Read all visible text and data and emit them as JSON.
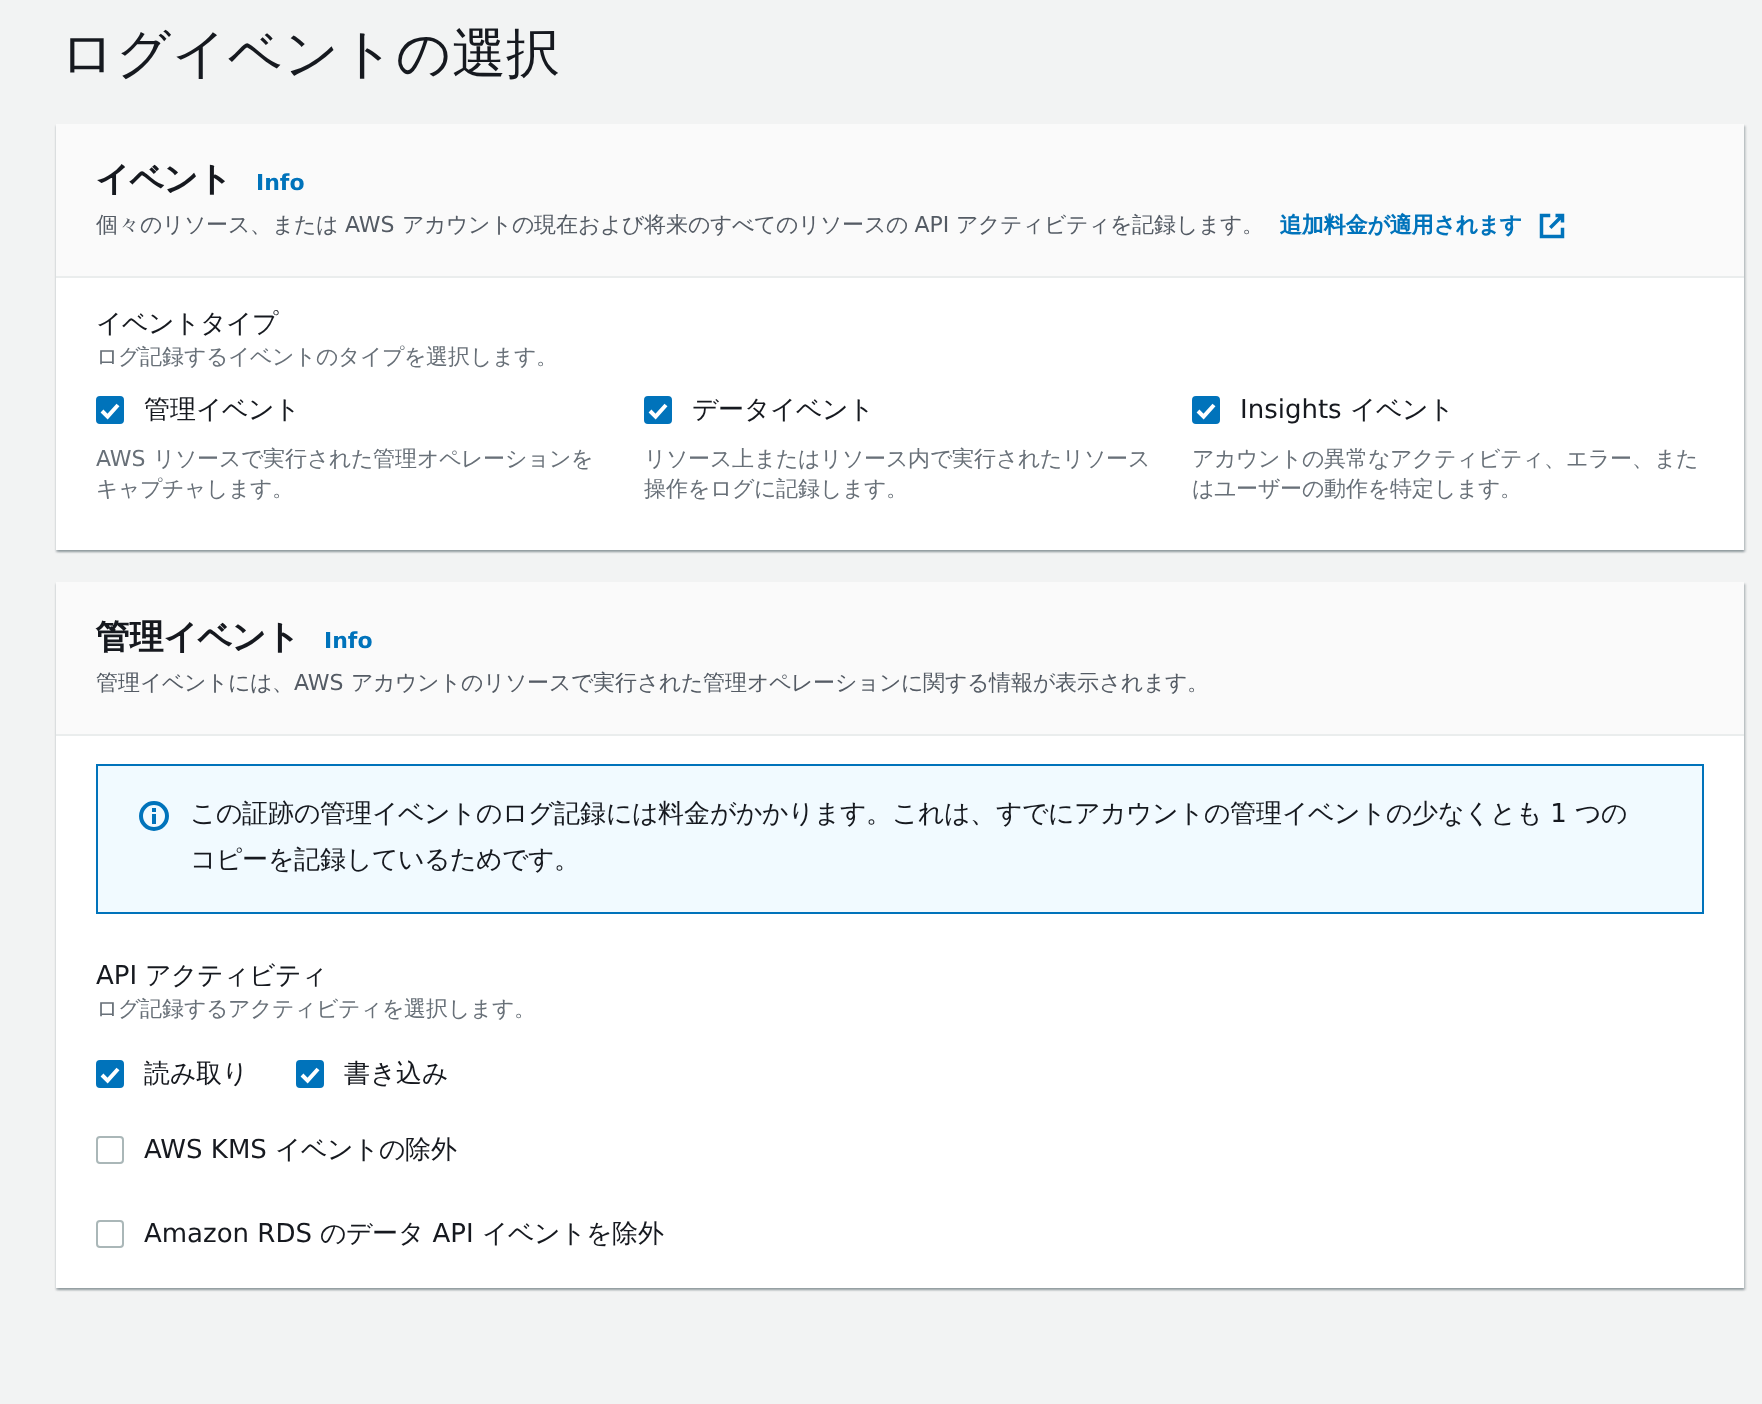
{
  "page_title": "ログイベントの選択",
  "events_panel": {
    "title": "イベント",
    "info": "Info",
    "description": "個々のリソース、または AWS アカウントの現在および将来のすべてのリソースの API アクティビティを記録します。",
    "link": "追加料金が適用されます",
    "event_type": {
      "label": "イベントタイプ",
      "hint": "ログ記録するイベントのタイプを選択します。",
      "options": [
        {
          "label": "管理イベント",
          "description": "AWS リソースで実行された管理オペレーションをキャプチャします。",
          "checked": true
        },
        {
          "label": "データイベント",
          "description": "リソース上またはリソース内で実行されたリソース操作をログに記録します。",
          "checked": true
        },
        {
          "label": "Insights イベント",
          "description": "アカウントの異常なアクティビティ、エラー、またはユーザーの動作を特定します。",
          "checked": true
        }
      ]
    }
  },
  "management_panel": {
    "title": "管理イベント",
    "info": "Info",
    "description": "管理イベントには、AWS アカウントのリソースで実行された管理オペレーションに関する情報が表示されます。",
    "alert": "この証跡の管理イベントのログ記録には料金がかかります。これは、すでにアカウントの管理イベントの少なくとも 1 つのコピーを記録しているためです。",
    "api_activity": {
      "label": "API アクティビティ",
      "hint": "ログ記録するアクティビティを選択します。",
      "options": [
        {
          "label": "読み取り",
          "checked": true
        },
        {
          "label": "書き込み",
          "checked": true
        }
      ]
    },
    "exclusions": [
      {
        "label": "AWS KMS イベントの除外",
        "checked": false
      },
      {
        "label": "Amazon RDS のデータ API イベントを除外",
        "checked": false
      }
    ]
  }
}
